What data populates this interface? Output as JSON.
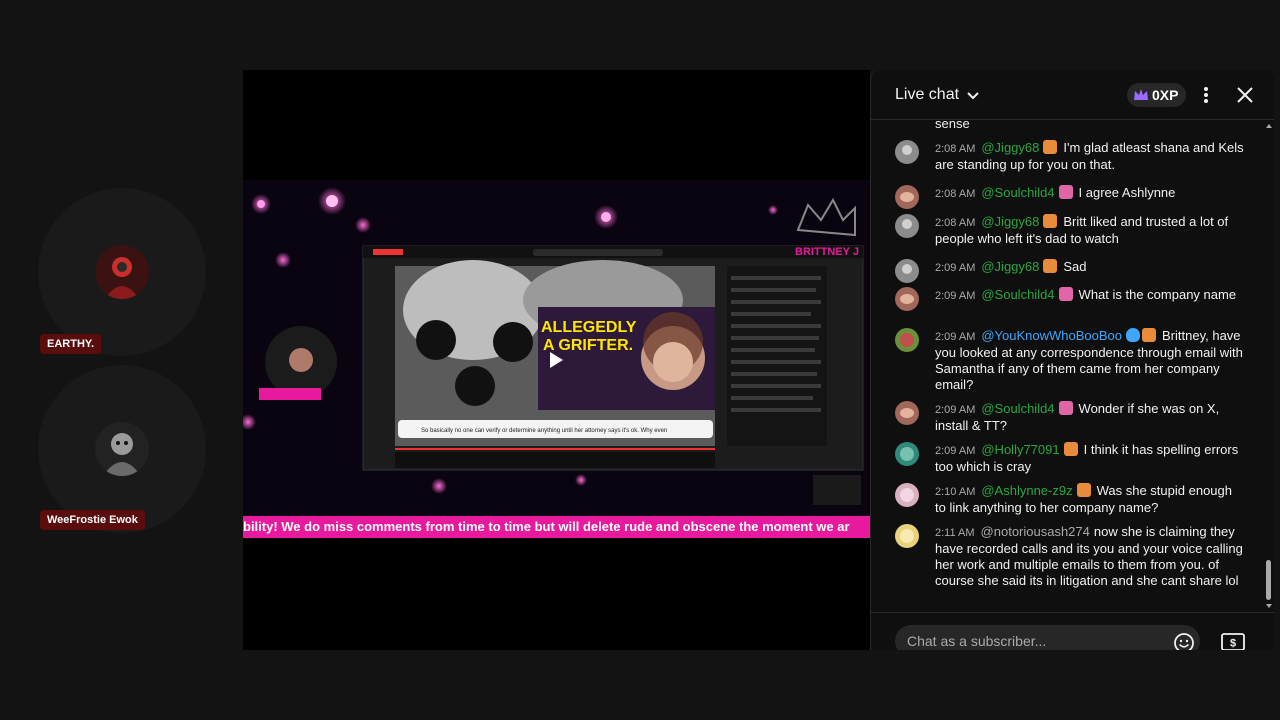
{
  "participants": [
    {
      "name": "EARTHY."
    },
    {
      "name": "WeeFrostie Ewok"
    }
  ],
  "stage": {
    "ticker_text": "bility! We do miss comments from time to time but will delete rude and obscene the moment we ar"
  },
  "chat": {
    "title": "Live chat",
    "xp": "0XP",
    "input_placeholder": "Chat as a subscriber...",
    "messages": [
      {
        "time": "",
        "author": "",
        "text": "sense",
        "author_color": "green"
      },
      {
        "time": "2:08 AM",
        "author": "@Jiggy68",
        "badge": "gift",
        "text": "I'm glad atleast shana and Kels are standing up for you on that."
      },
      {
        "time": "2:08 AM",
        "author": "@Soulchild4",
        "badge": "cat",
        "text": "I agree Ashlynne"
      },
      {
        "time": "2:08 AM",
        "author": "@Jiggy68",
        "badge": "gift",
        "text": "Britt liked and trusted a lot of people who left it's dad to watch"
      },
      {
        "time": "2:09 AM",
        "author": "@Jiggy68",
        "badge": "gift",
        "text": "Sad"
      },
      {
        "time": "2:09 AM",
        "author": "@Soulchild4",
        "badge": "cat",
        "text": "What is the company name"
      },
      {
        "time": "2:09 AM",
        "author": "@YouKnowWhoBooBoo",
        "badge": "shield-gift",
        "text": "Brittney, have you looked at any correspondence through email with Samantha if any of them came from her company email?",
        "author_color": "blue"
      },
      {
        "time": "2:09 AM",
        "author": "@Soulchild4",
        "badge": "cat",
        "text": "Wonder if she was on X, install & TT?"
      },
      {
        "time": "2:09 AM",
        "author": "@Holly77091",
        "badge": "gift",
        "text": "I think it has spelling errors too which is cray"
      },
      {
        "time": "2:10 AM",
        "author": "@Ashlynne-z9z",
        "badge": "gift",
        "text": "Was she stupid enough to link anything to her company name?"
      },
      {
        "time": "2:11 AM",
        "author": "@notoriousash274",
        "badge": "",
        "text": "now she is claiming they have recorded calls and its you and your voice calling her work and multiple emails to them from you. of course she said its in litigation and she cant share lol",
        "author_color": "gray"
      }
    ]
  },
  "colors": {
    "accent_pink": "#e7199c",
    "author_green": "#2ba640",
    "author_blue": "#3ea6ff",
    "name_tag_bg": "#5b0d0d"
  },
  "icons": [
    "chevron-down-icon",
    "crown-icon",
    "more-vert-icon",
    "close-icon",
    "emoji-icon",
    "super-chat-icon"
  ]
}
